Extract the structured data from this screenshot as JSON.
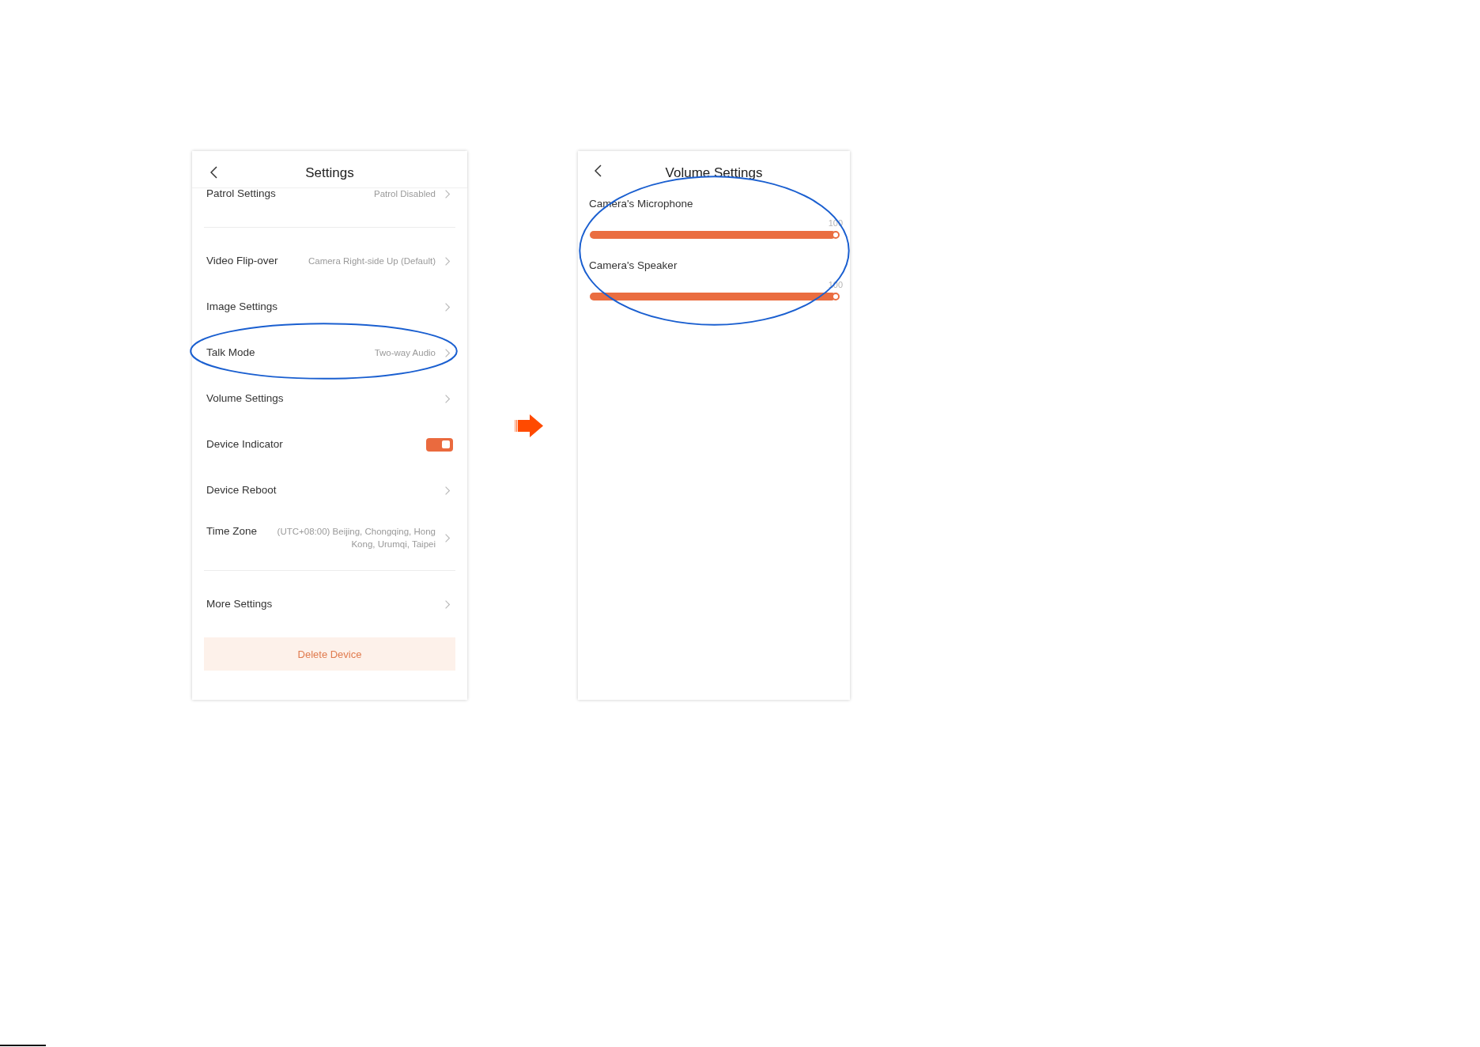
{
  "settings_screen": {
    "title": "Settings",
    "sections": [
      {
        "rows": [
          {
            "kind": "link",
            "label": "Patrol Settings",
            "value": "Patrol Disabled",
            "circled": false
          }
        ]
      },
      {
        "rows": [
          {
            "kind": "link",
            "label": "Video Flip-over",
            "value": "Camera Right-side Up (Default)",
            "circled": false
          },
          {
            "kind": "link",
            "label": "Image Settings",
            "circled": false
          },
          {
            "kind": "link",
            "label": "Talk Mode",
            "value": "Two-way Audio",
            "circled": true
          },
          {
            "kind": "link",
            "label": "Volume Settings",
            "circled": false
          },
          {
            "kind": "toggle",
            "label": "Device Indicator",
            "on": true,
            "circled": false
          },
          {
            "kind": "link",
            "label": "Device Reboot",
            "circled": false
          },
          {
            "kind": "link",
            "label": "Time Zone",
            "value": "(UTC+08:00) Beijing, Chongqing, Hong Kong, Urumqi, Taipei",
            "circled": false
          }
        ]
      },
      {
        "rows": [
          {
            "kind": "link",
            "label": "More Settings",
            "circled": false
          }
        ]
      }
    ],
    "delete_button": "Delete Device"
  },
  "volume_screen": {
    "title": "Volume Settings",
    "circled": true,
    "sliders": [
      {
        "label": "Camera's Microphone",
        "reading": "100",
        "level": 1
      },
      {
        "label": "Camera's Speaker",
        "reading": "100",
        "level": 1
      }
    ]
  }
}
